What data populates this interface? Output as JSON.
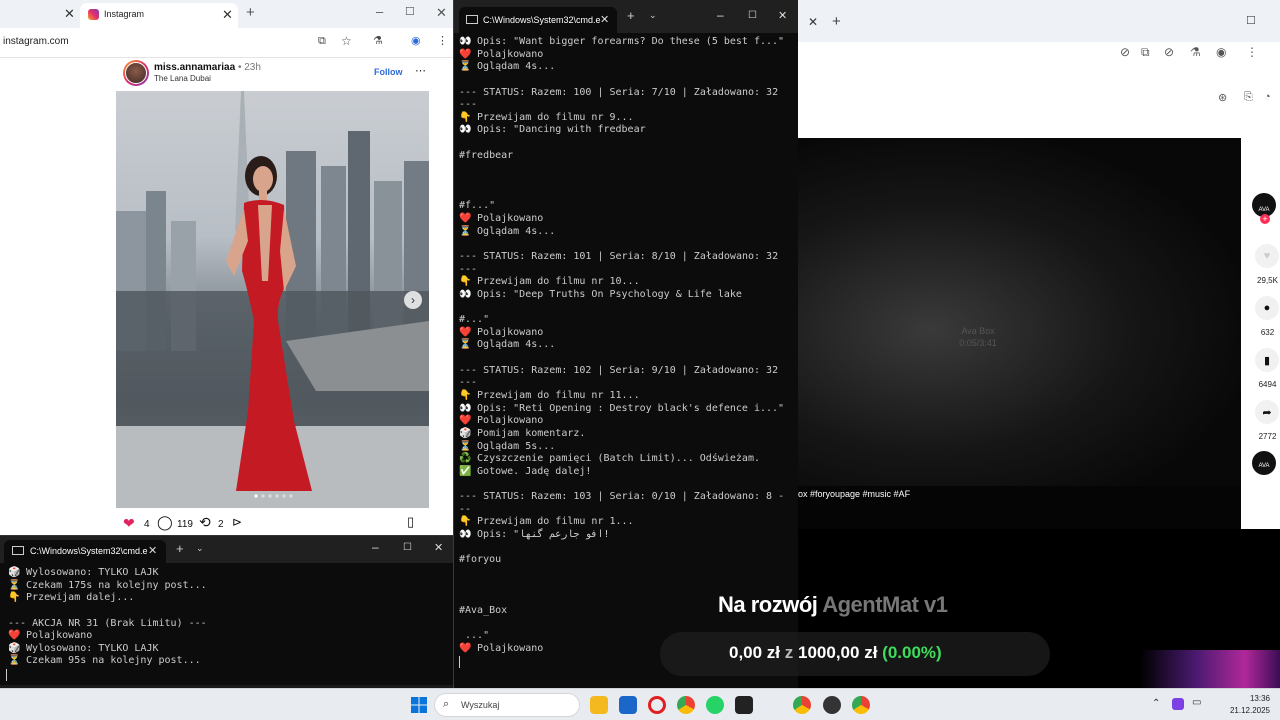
{
  "browser_left": {
    "tab_title": "Instagram",
    "url": "instagram.com",
    "post": {
      "username": "miss.annamariaa",
      "age": "23h",
      "location": "The Lana Dubai",
      "follow_label": "Follow",
      "likes": "4",
      "comments": "119",
      "reposts": "2"
    }
  },
  "cmd_small": {
    "title": "C:\\Windows\\System32\\cmd.e",
    "lines": [
      {
        "icon": "🎲",
        "text": "Wylosowano: TYLKO LAJK"
      },
      {
        "icon": "⏳",
        "text": "Czekam 175s na kolejny post..."
      },
      {
        "icon": "👇",
        "text": "Przewijam dalej..."
      },
      {
        "icon": "",
        "text": ""
      },
      {
        "icon": "",
        "text": "--- AKCJA NR 31 (Brak Limitu) ---"
      },
      {
        "icon": "❤️",
        "text": "Polajkowano"
      },
      {
        "icon": "🎲",
        "text": "Wylosowano: TYLKO LAJK"
      },
      {
        "icon": "⏳",
        "text": "Czekam 95s na kolejny post..."
      }
    ]
  },
  "cmd_main": {
    "title": "C:\\Windows\\System32\\cmd.e",
    "lines": [
      {
        "icon": "👀",
        "text": "Opis: \"Want bigger forearms? Do these (5 best f...\""
      },
      {
        "icon": "❤️",
        "text": "Polajkowano"
      },
      {
        "icon": "⏳",
        "text": "Oglądam 4s..."
      },
      {
        "icon": "",
        "text": ""
      },
      {
        "icon": "",
        "text": "--- STATUS: Razem: 100 | Seria: 7/10 | Załadowano: 32"
      },
      {
        "icon": "",
        "text": "---"
      },
      {
        "icon": "👇",
        "text": "Przewijam do filmu nr 9..."
      },
      {
        "icon": "👀",
        "text": "Opis: \"Dancing with fredbear"
      },
      {
        "icon": "",
        "text": ""
      },
      {
        "icon": "",
        "text": "#fredbear"
      },
      {
        "icon": "",
        "text": ""
      },
      {
        "icon": "",
        "text": ""
      },
      {
        "icon": "",
        "text": ""
      },
      {
        "icon": "",
        "text": "#f...\""
      },
      {
        "icon": "❤️",
        "text": "Polajkowano"
      },
      {
        "icon": "⏳",
        "text": "Oglądam 4s..."
      },
      {
        "icon": "",
        "text": ""
      },
      {
        "icon": "",
        "text": "--- STATUS: Razem: 101 | Seria: 8/10 | Załadowano: 32"
      },
      {
        "icon": "",
        "text": "---"
      },
      {
        "icon": "👇",
        "text": "Przewijam do filmu nr 10..."
      },
      {
        "icon": "👀",
        "text": "Opis: \"Deep Truths On Psychology & Life lake"
      },
      {
        "icon": "",
        "text": ""
      },
      {
        "icon": "",
        "text": "#...\""
      },
      {
        "icon": "❤️",
        "text": "Polajkowano"
      },
      {
        "icon": "⏳",
        "text": "Oglądam 4s..."
      },
      {
        "icon": "",
        "text": ""
      },
      {
        "icon": "",
        "text": "--- STATUS: Razem: 102 | Seria: 9/10 | Załadowano: 32"
      },
      {
        "icon": "",
        "text": "---"
      },
      {
        "icon": "👇",
        "text": "Przewijam do filmu nr 11..."
      },
      {
        "icon": "👀",
        "text": "Opis: \"Reti Opening : Destroy black's defence i...\""
      },
      {
        "icon": "❤️",
        "text": "Polajkowano"
      },
      {
        "icon": "🎲",
        "text": "Pomijam komentarz."
      },
      {
        "icon": "⏳",
        "text": "Oglądam 5s..."
      },
      {
        "icon": "♻️",
        "text": "Czyszczenie pamięci (Batch Limit)... Odświeżam."
      },
      {
        "icon": "✅",
        "text": "Gotowe. Jadę dalej!"
      },
      {
        "icon": "",
        "text": ""
      },
      {
        "icon": "",
        "text": "--- STATUS: Razem: 103 | Seria: 0/10 | Załadowano: 8 -"
      },
      {
        "icon": "",
        "text": "--"
      },
      {
        "icon": "👇",
        "text": "Przewijam do filmu nr 1..."
      },
      {
        "icon": "👀",
        "text": "Opis: \"افو جارعم گنها!"
      },
      {
        "icon": "",
        "text": ""
      },
      {
        "icon": "",
        "text": "#foryou"
      },
      {
        "icon": "",
        "text": ""
      },
      {
        "icon": "",
        "text": ""
      },
      {
        "icon": "",
        "text": ""
      },
      {
        "icon": "",
        "text": "#Ava_Box"
      },
      {
        "icon": "",
        "text": ""
      },
      {
        "icon": "",
        "text": " ...\""
      },
      {
        "icon": "❤️",
        "text": "Polajkowano"
      }
    ]
  },
  "video": {
    "caption": "ox #foryoupage #music #AF",
    "overlay_title": "Ava Box",
    "overlay_time": "0:05/3:41",
    "side_counts": [
      "29,5K",
      "632",
      "6494",
      "2772"
    ],
    "side_label": "AVA"
  },
  "overlay": {
    "title_main": "Na rozwój ",
    "title_dim": "AgentMat v1",
    "amount": "0,00 zł",
    "sep": "z",
    "goal": "1000,00 zł",
    "percent": "(0.00%)"
  },
  "taskbar": {
    "search_placeholder": "Wyszukaj",
    "time": "13:36",
    "date": "21.12.2025"
  },
  "colors": {
    "cmd_bg": "#0c0c0c",
    "cmd_text": "#cccccc",
    "accent_green": "#3ddc5b",
    "instagram_follow": "#2b6cd9",
    "dress_red": "#c41a24"
  }
}
